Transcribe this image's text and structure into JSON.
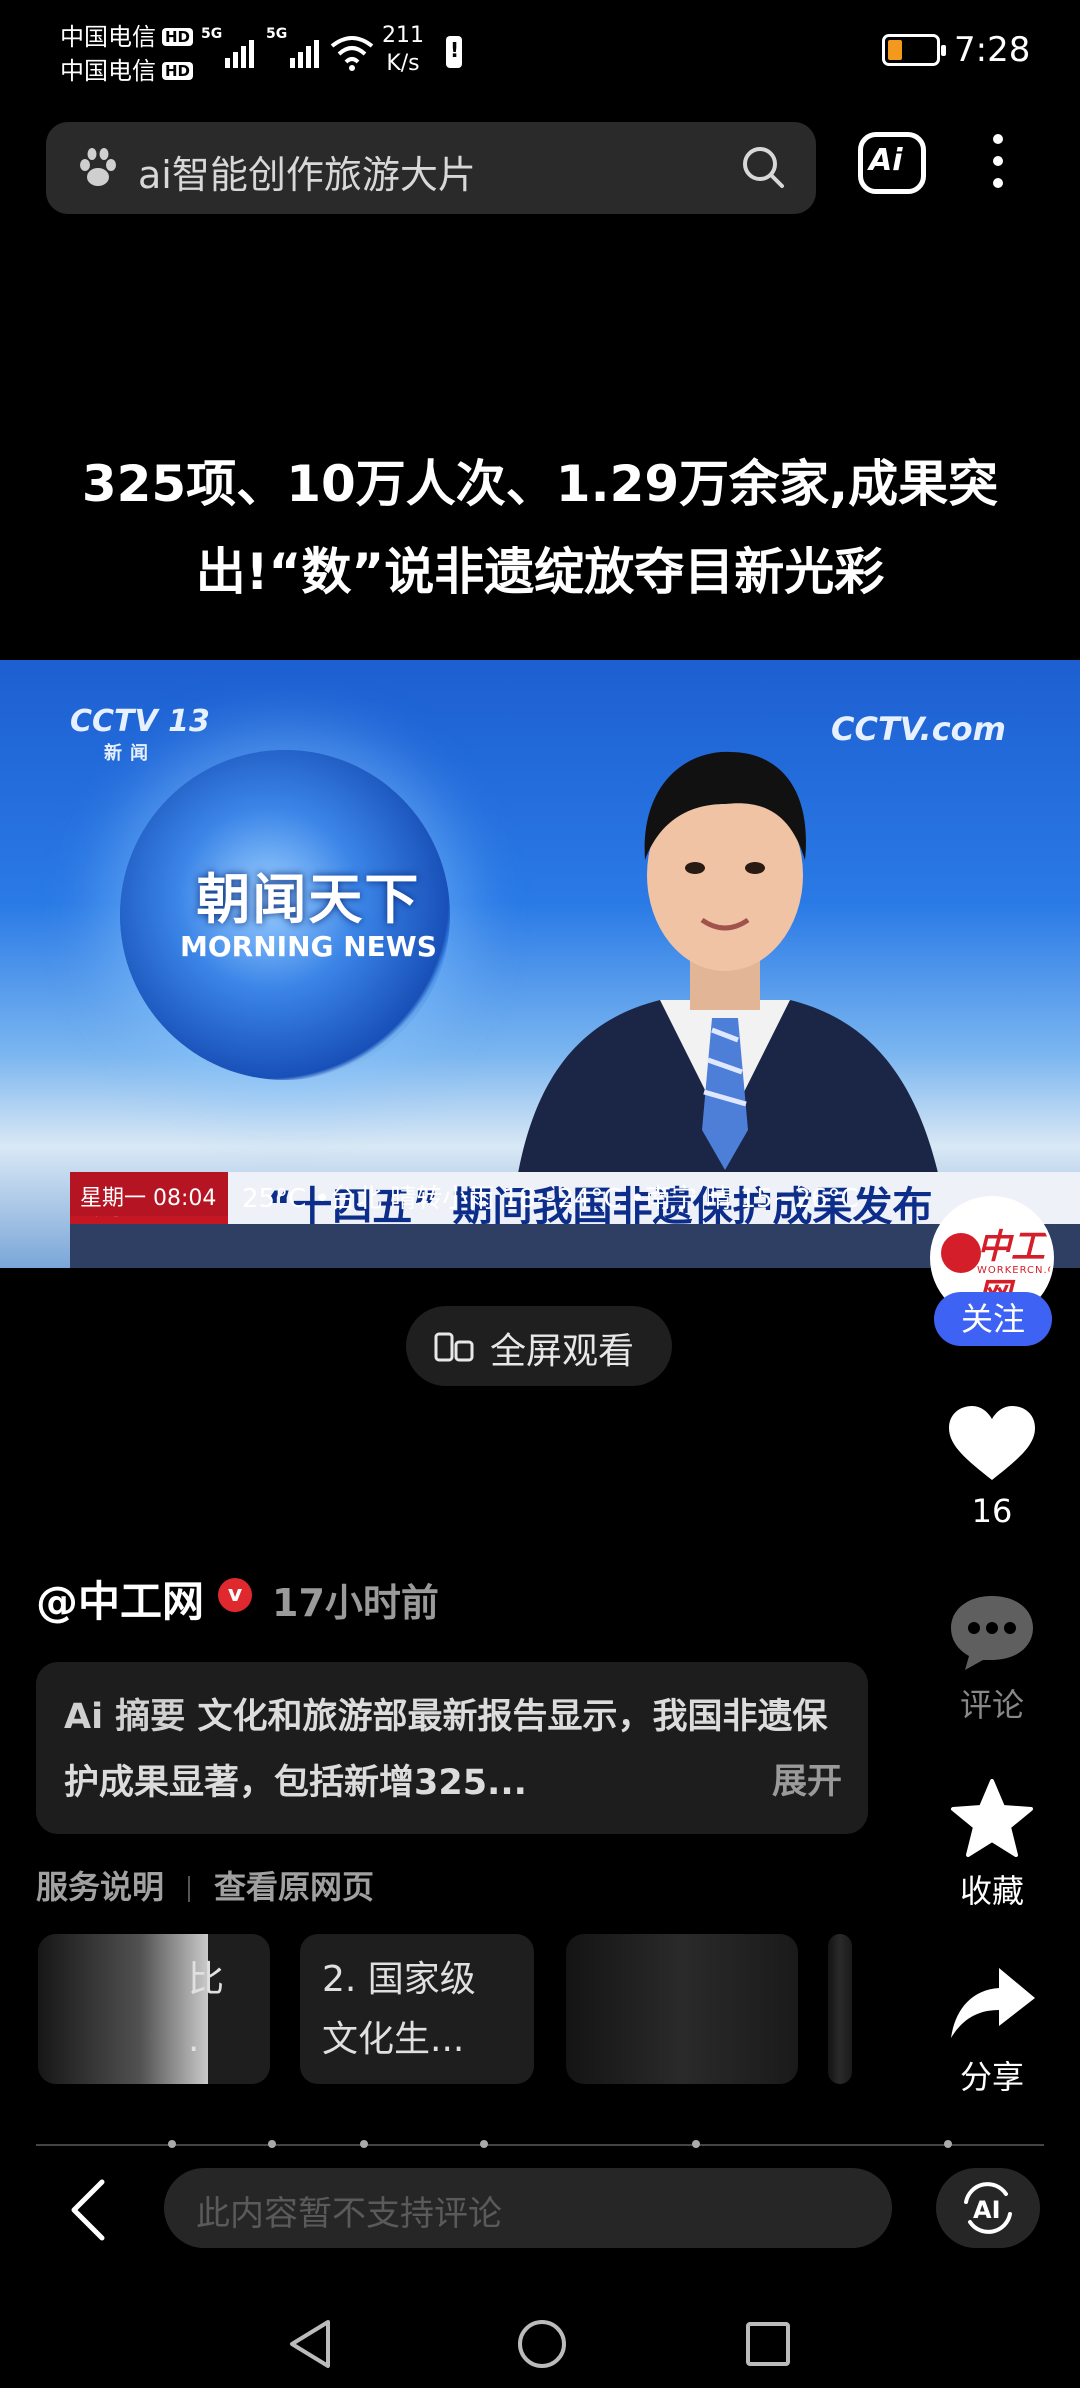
{
  "status_bar": {
    "carrier1": "中国电信",
    "carrier2": "中国电信",
    "hd": "HD",
    "net1": "5G",
    "net2": "5G",
    "speed_value": "211",
    "speed_unit": "K/s",
    "time": "7:28",
    "battery_level": 0.2,
    "icons": [
      "hd-icon",
      "signal-icon",
      "wifi-icon",
      "notification-icon",
      "nfc-icon",
      "alarm-icon",
      "bluetooth-icon",
      "vibrate-icon",
      "battery-icon"
    ]
  },
  "search": {
    "query": "ai智能创作旅游大片",
    "ai_button": "Ai"
  },
  "article": {
    "title": "325项、10万人次、1.29万余家,成果突出!“数”说非遗绽放夺目新光彩"
  },
  "video": {
    "cctv_channel": "CCTV 13",
    "cctv_sub": "新闻",
    "cctv_right": "CCTV.com",
    "show_cn": "朝闻天下",
    "show_en": "MORNING NEWS",
    "ticker_logo": "朝闻天下",
    "ticker_headline": "“十四五” 期间我国非遗保护成果发布",
    "ticker_date": "星期一 08:04",
    "ticker_weather": "25°C  •台北 晴转小雨 18~24°C  •南宁 晴 15~26°C"
  },
  "fullscreen": {
    "label": "全屏观看"
  },
  "channel": {
    "avatar_name": "中工网",
    "avatar_sub": "WORKERCN.CN",
    "follow_label": "关注"
  },
  "rail": {
    "like_count": "16",
    "comment_label": "评论",
    "favorite_label": "收藏",
    "share_label": "分享"
  },
  "author": {
    "name": "@中工网",
    "verified": "v",
    "time": "17小时前"
  },
  "summary": {
    "ai_tag": "Ai 摘要",
    "text": "文化和旅游部最新报告显示，我国非遗保护成果显著，包括新增325...",
    "expand": "展开"
  },
  "links": {
    "service": "服务说明",
    "original": "查看原网页"
  },
  "cards": [
    {
      "text_line1": "比",
      "text_line2": "."
    },
    {
      "text_line1": "2. 国家级",
      "text_line2": "文化生..."
    },
    {
      "text_line1": "",
      "text_line2": ""
    },
    {
      "text_line1": "",
      "text_line2": ""
    }
  ],
  "comment_bar": {
    "placeholder": "此内容暂不支持评论",
    "ai_label": "AI"
  },
  "nav": {
    "icons": [
      "back-triangle-icon",
      "home-circle-icon",
      "recents-square-icon"
    ]
  }
}
